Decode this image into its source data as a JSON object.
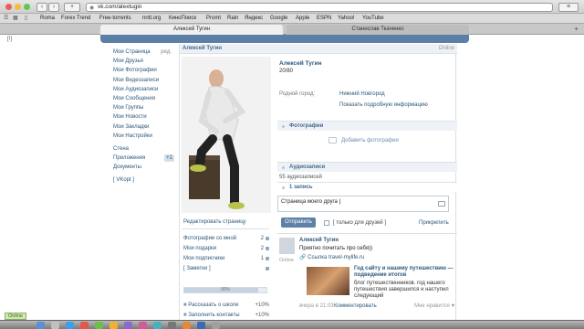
{
  "browser": {
    "url": "vk.com/alextugin",
    "bookmarks": [
      "Roma",
      "Forex Trend",
      "Free-torrents",
      "nntt.org",
      "КиноПоиск",
      "Promt",
      "Rain",
      "Яндекс",
      "Google",
      "Apple",
      "ESPN",
      "Yahoo!",
      "YouTube"
    ],
    "tabs": [
      "Алексей Тугин",
      "Станислав Ткаченко"
    ],
    "side_marker": "[!]"
  },
  "menu": {
    "items": [
      "Мои Страница",
      "Мои Друзья",
      "Мои Фотографии",
      "Мои Видеозаписи",
      "Мои Аудиозаписи",
      "Мои Сообщения",
      "Мои Группы",
      "Мои Новости",
      "Мои Закладки",
      "Мои Настройки"
    ],
    "edit_label": "ред.",
    "extra": [
      "Стена",
      "Приложения",
      "Документы",
      "[ VKopt ]"
    ],
    "apps_count": "+1"
  },
  "profile": {
    "header_name": "Алексей Тугин",
    "online": "Online",
    "name": "Алексей Тугин",
    "age": "20/80",
    "city_label": "Родной город:",
    "city": "Нижний Новгород",
    "more_info": "Показать подробную информацию",
    "edit_page": "Редактировать страницу",
    "stats": [
      {
        "label": "Фотографии со мной",
        "value": "2"
      },
      {
        "label": "Мои подарки",
        "value": "2"
      },
      {
        "label": "Мои подписчики",
        "value": "1"
      },
      {
        "label": "[ Заметки ]",
        "value": ""
      }
    ],
    "completion": "90%",
    "completion_value": 0.9,
    "tips": [
      {
        "label": "Рассказать о школе",
        "value": "+10%"
      },
      {
        "label": "Заполнить контакты",
        "value": "+10%"
      }
    ]
  },
  "photos": {
    "title": "Фотографии",
    "add": "Добавить фотографии"
  },
  "audio": {
    "title": "Аудиозаписи",
    "count": "55 аудиозаписей"
  },
  "wall": {
    "title": "1 запись",
    "input_value": "Страница моего друга",
    "send": "Отправить",
    "friends_only": "[ только для друзей ]",
    "attach": "Прикрепить"
  },
  "post": {
    "author": "Алексей Тугин",
    "text": "Приятно почитать про себя))",
    "link": "Ссылка travel-mylife.ru",
    "author_status": "Online",
    "card_title": "Год сайту и нашему путешествию — подведение итогов",
    "card_text": "блог путешественников. год нашего путешествия завершился и наступил следующий",
    "time": "вчера в 21:03",
    "comment": "Комментировать",
    "like": "Мне нравится"
  },
  "taskbar": {
    "online": "Online"
  },
  "colors": {
    "accent": "#5b7fa6",
    "link": "#2b587a",
    "panel": "#eef2f6"
  }
}
